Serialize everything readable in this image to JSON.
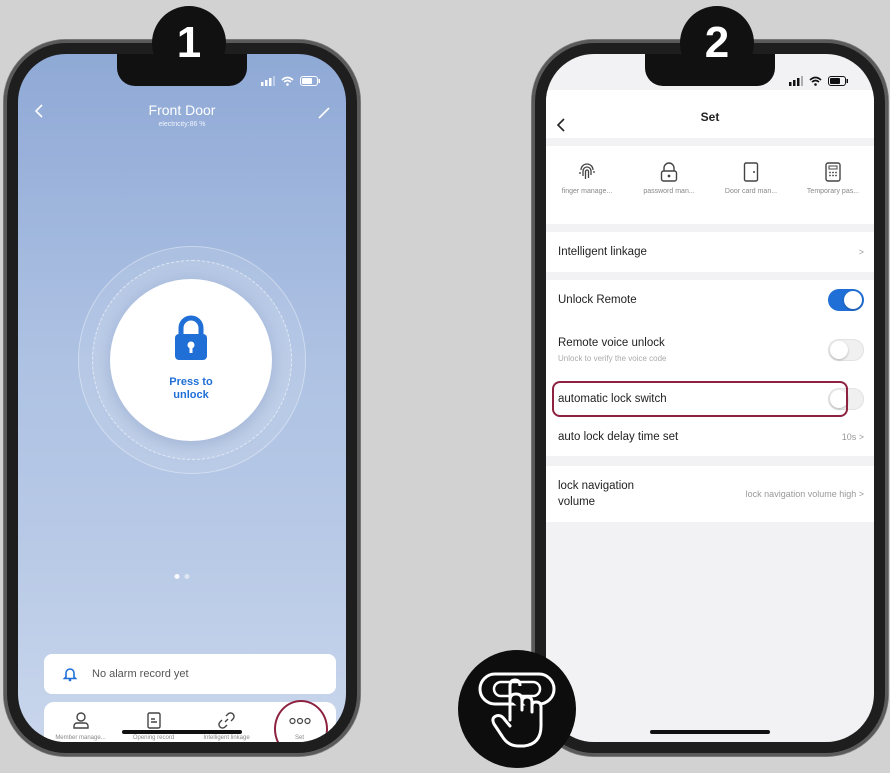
{
  "badges": {
    "step1": "1",
    "step2": "2"
  },
  "phone1": {
    "title": "Front Door",
    "subtitle": "electricity:86 %",
    "lock_button_label": "Press to unlock",
    "alarm_text": "No alarm record yet",
    "tabs": [
      {
        "label": "Member manage...",
        "icon": "person-icon"
      },
      {
        "label": "Opening record",
        "icon": "document-icon"
      },
      {
        "label": "Intelligent linkage",
        "icon": "link-icon"
      },
      {
        "label": "Set",
        "icon": "more-dots-icon"
      }
    ]
  },
  "phone2": {
    "title": "Set",
    "features": [
      {
        "label": "finger manage...",
        "icon": "fingerprint-icon"
      },
      {
        "label": "password man...",
        "icon": "padlock-icon"
      },
      {
        "label": "Door card man...",
        "icon": "door-icon"
      },
      {
        "label": "Temporary pas...",
        "icon": "keypad-icon"
      }
    ],
    "rows": {
      "intelligent_linkage": {
        "label": "Intelligent linkage",
        "chevron": ">"
      },
      "unlock_remote": {
        "label": "Unlock Remote",
        "toggle": true
      },
      "remote_voice": {
        "label": "Remote voice unlock",
        "sub": "Unlock to verify the voice code",
        "toggle": false
      },
      "auto_lock": {
        "label": "automatic lock switch",
        "toggle": false
      },
      "auto_lock_delay": {
        "label": "auto lock delay time set",
        "value": "10s >"
      },
      "lock_nav": {
        "label_line1": "lock navigation",
        "label_line2": "volume",
        "value": "lock navigation volume high >"
      }
    }
  },
  "colors": {
    "accent": "#1f6fd6",
    "highlight": "#8c2240"
  }
}
